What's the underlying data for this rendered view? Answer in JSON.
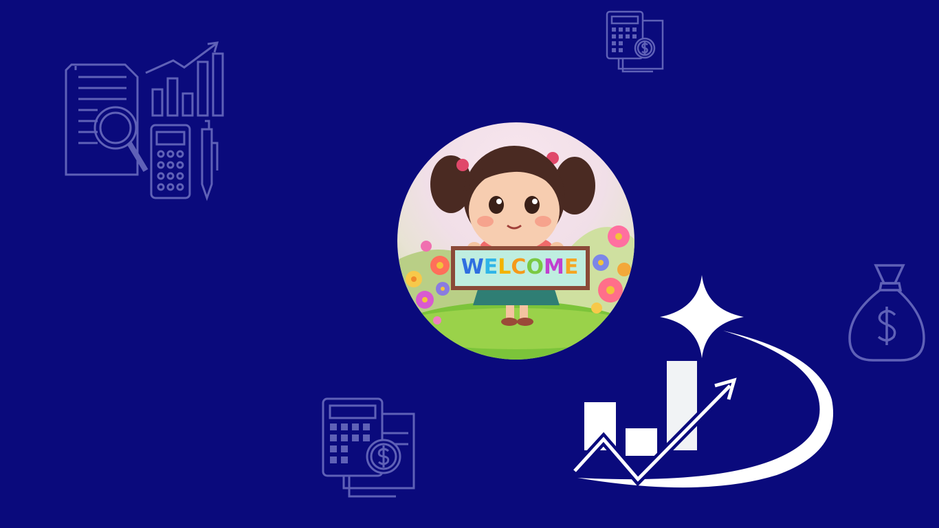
{
  "background_color": "#0a0a7c",
  "icon_color": "#7b80d6",
  "decorative_icons": [
    "report-analysis-icon",
    "calculator-invoice-icon",
    "money-bag-icon",
    "calculator-invoice-icon"
  ],
  "avatar": {
    "sign_text": "WELCOME",
    "sign_letter_colors": [
      "#2f6fe0",
      "#2fb5e8",
      "#f3b300",
      "#f59a1a",
      "#7ac943",
      "#c13fd0",
      "#f5a623"
    ]
  },
  "logo": {
    "icon": "growth-chart-sparkle-icon",
    "color": "#ffffff"
  }
}
